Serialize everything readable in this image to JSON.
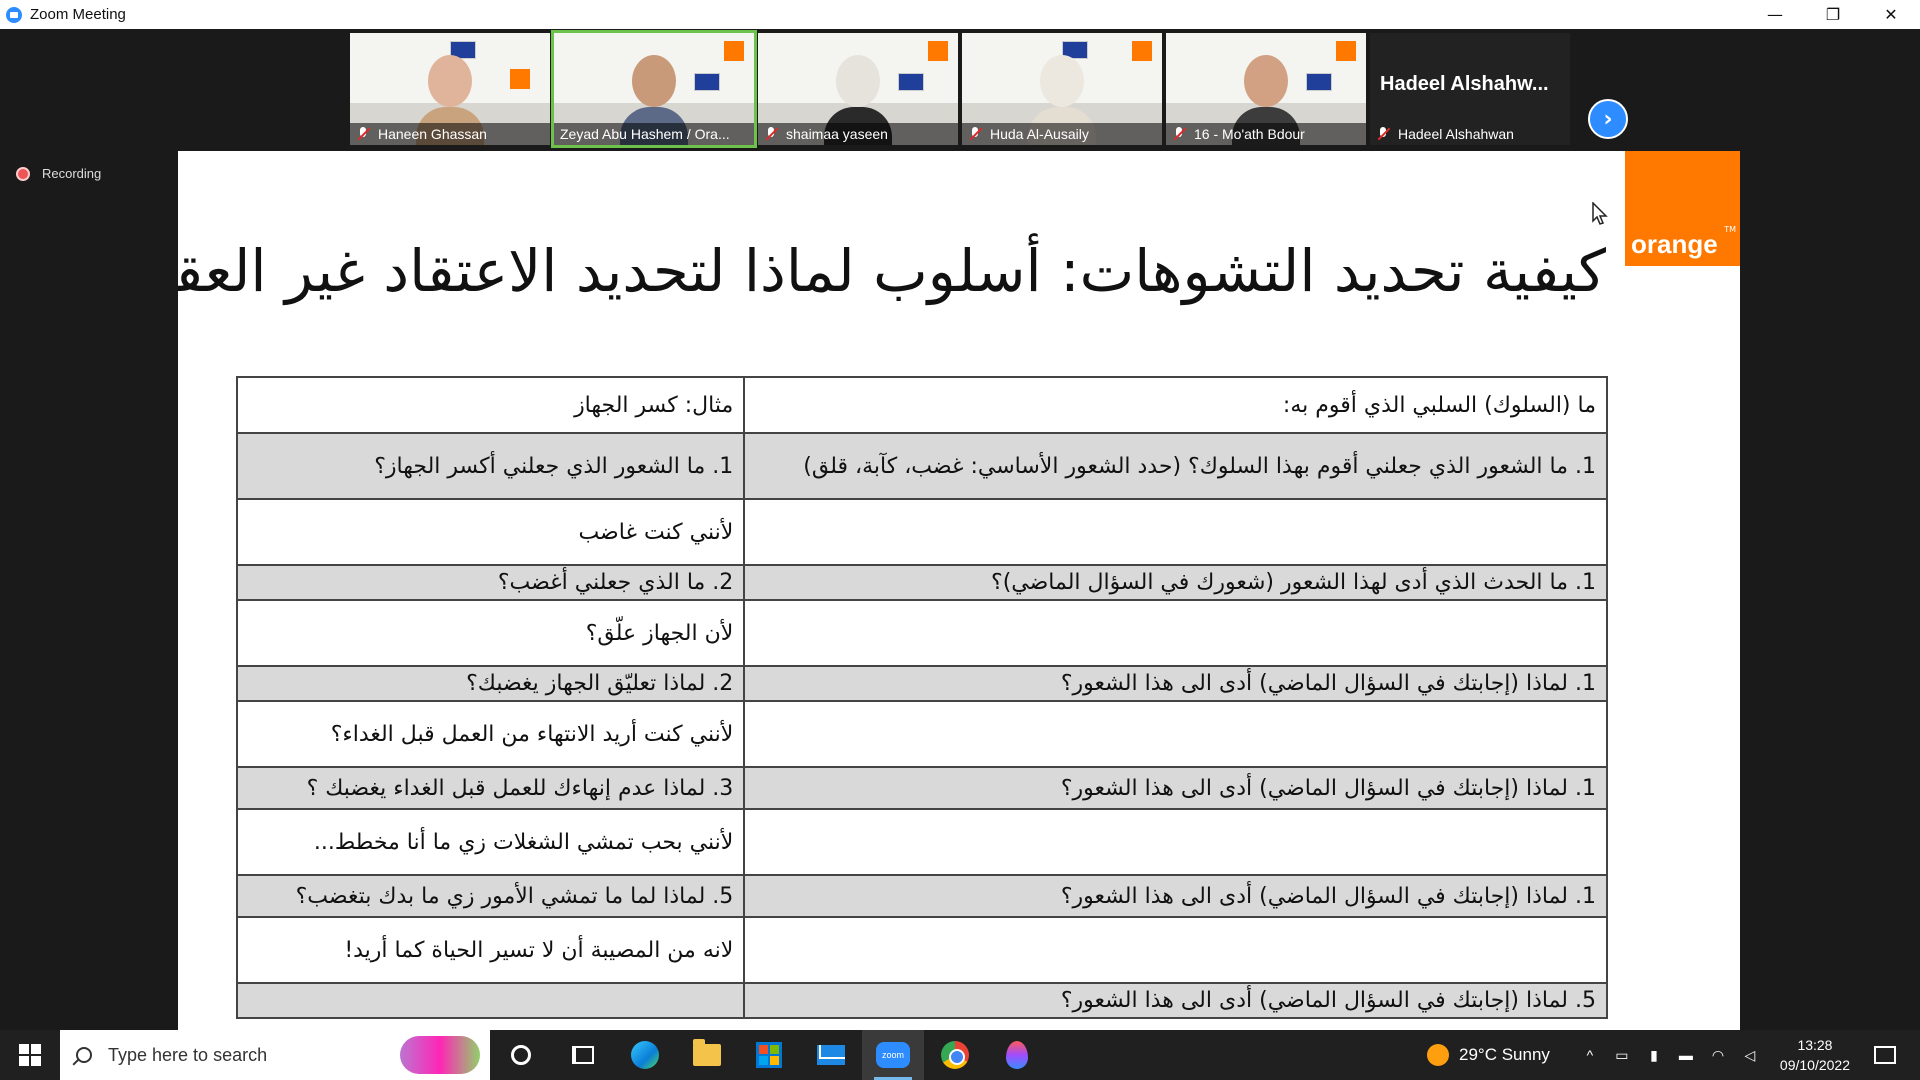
{
  "window": {
    "title": "Zoom Meeting",
    "controls": {
      "minimize": "—",
      "restore": "❐",
      "close": "✕"
    }
  },
  "participants": [
    {
      "name": "Haneen Ghassan",
      "muted": true,
      "active": false
    },
    {
      "name": "Zeyad Abu Hashem / Ora...",
      "muted": false,
      "active": true
    },
    {
      "name": "shaimaa yaseen",
      "muted": true,
      "active": false
    },
    {
      "name": "Huda Al-Ausaily",
      "muted": true,
      "active": false
    },
    {
      "name": "16 - Mo'ath Bdour",
      "muted": true,
      "active": false
    }
  ],
  "text_participant": {
    "display": "Hadeel  Alshahw...",
    "name": "Hadeel Alshahwan",
    "muted": true
  },
  "next_page_icon": "›",
  "recording_label": "Recording",
  "slide": {
    "logo": "orange",
    "logo_tm": "TM",
    "title": "كيفية تحديد التشوهات: أسلوب لماذا لتحديد الاعتقاد غير العقلاني",
    "rows": [
      {
        "right": "ما (السلوك) السلبي الذي أقوم به:",
        "left": "مثال: كسر الجهاز",
        "shade": false
      },
      {
        "right": "1.   ما الشعور الذي جعلني أقوم بهذا السلوك؟ (حدد الشعور الأساسي: غضب، كآبة، قلق)",
        "left": "1. ما الشعور الذي جعلني أكسر الجهاز؟",
        "shade": true
      },
      {
        "right": "",
        "left": "لأنني كنت غاضب",
        "shade": false
      },
      {
        "right": "1.   ما الحدث الذي أدى لهذا الشعور (شعورك في السؤال الماضي)؟",
        "left": "2. ما الذي جعلني أغضب؟",
        "shade": true
      },
      {
        "right": "",
        "left": "لأن الجهاز علّق؟",
        "shade": false
      },
      {
        "right": "1.   لماذا (إجابتك في السؤال الماضي) أدى الى هذا الشعور؟",
        "left": "2. لماذا تعليّق الجهاز يغضبك؟",
        "shade": true
      },
      {
        "right": "",
        "left": "لأنني كنت أريد الانتهاء من العمل قبل الغداء؟",
        "shade": false
      },
      {
        "right": "1.   لماذا (إجابتك في السؤال الماضي) أدى الى هذا الشعور؟",
        "left": "3. لماذا عدم إنهاءك للعمل قبل الغداء يغضبك ؟",
        "shade": true
      },
      {
        "right": "",
        "left": "لأنني بحب تمشي الشغلات زي ما أنا مخطط...",
        "shade": false
      },
      {
        "right": "1.   لماذا (إجابتك في السؤال الماضي) أدى الى هذا الشعور؟",
        "left": "5. لماذا لما ما تمشي الأمور زي ما بدك بتغضب؟",
        "shade": true
      },
      {
        "right": "",
        "left": "لانه من المصيبة أن لا تسير الحياة كما أريد!",
        "shade": false
      },
      {
        "right": "5. لماذا (إجابتك في السؤال الماضي) أدى الى هذا الشعور؟",
        "left": "",
        "shade": true
      }
    ]
  },
  "taskbar": {
    "search_placeholder": "Type here to search",
    "zoom_icon_text": "zoom",
    "weather": "29°C  Sunny",
    "time": "13:28",
    "date": "09/10/2022",
    "tray_chevron": "^"
  }
}
